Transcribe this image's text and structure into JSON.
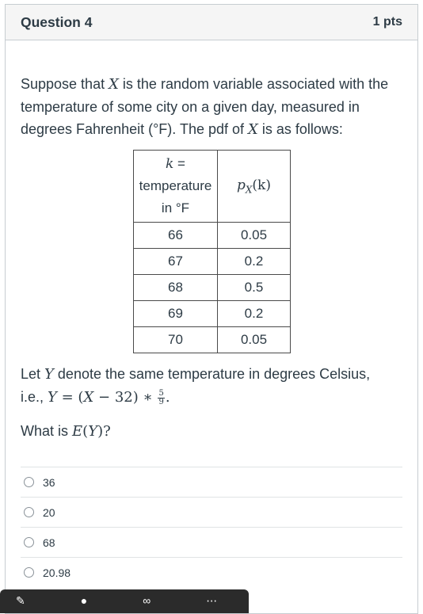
{
  "header": {
    "title": "Question 4",
    "points": "1 pts"
  },
  "question": {
    "intro_1": "Suppose that ",
    "var_x": "X",
    "intro_2": " is the random variable associated with the temperature of some city on a given day, measured in degrees Fahrenheit (°F). The pdf of ",
    "var_x2": "X",
    "intro_3": " is as follows:",
    "table": {
      "col1_header_var": "k",
      "col1_header_eq": " =",
      "col1_header_line2": "temperature",
      "col1_header_line3": "in °F",
      "col2_header": "p",
      "col2_sub": "X",
      "col2_arg": "(k)",
      "rows": [
        {
          "k": "66",
          "p": "0.05"
        },
        {
          "k": "67",
          "p": "0.2"
        },
        {
          "k": "68",
          "p": "0.5"
        },
        {
          "k": "69",
          "p": "0.2"
        },
        {
          "k": "70",
          "p": "0.05"
        }
      ]
    },
    "let_1": "Let ",
    "var_y": "Y",
    "let_2": " denote the same temperature in degrees Celsius,",
    "ie": "i.e., ",
    "formula_y": "Y",
    "formula_mid": " = (",
    "formula_x": "X",
    "formula_rest": " − 32) ∗ ",
    "frac_num": "5",
    "frac_den": "9",
    "formula_end": ".",
    "what_1": "What is ",
    "what_e": "E",
    "what_2": "(",
    "what_y": "Y",
    "what_3": ")?"
  },
  "answers": [
    {
      "label": "36"
    },
    {
      "label": "20"
    },
    {
      "label": "68"
    },
    {
      "label": "20.98"
    }
  ],
  "toolbar": {
    "icon_names": [
      "pencil-icon",
      "pin-icon",
      "link-icon",
      "more-icon"
    ]
  }
}
